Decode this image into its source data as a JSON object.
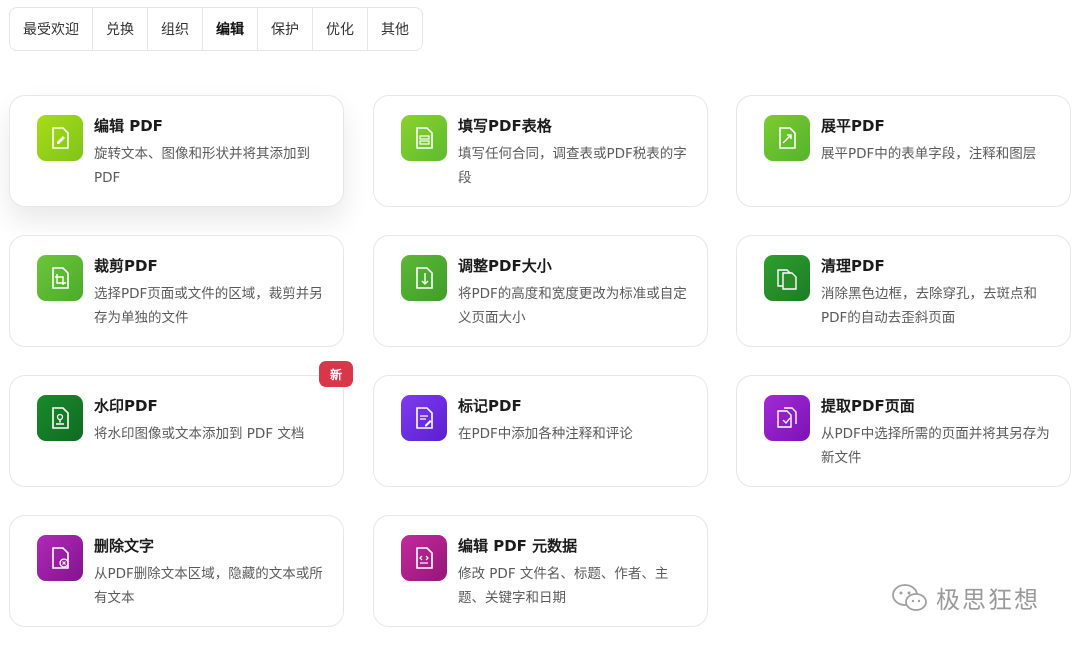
{
  "tabs": [
    "最受欢迎",
    "兑换",
    "组织",
    "编辑",
    "保护",
    "优化",
    "其他"
  ],
  "active_tab": "编辑",
  "cards": [
    {
      "title": "编辑 PDF",
      "desc": "旋转文本、图像和形状并将其添加到 PDF",
      "icon": "edit-pdf-icon",
      "color1": "#a8dc18",
      "color2": "#7fc41a"
    },
    {
      "title": "填写PDF表格",
      "desc": "填写任何合同，调查表或PDF税表的字段",
      "icon": "fill-form-icon",
      "color1": "#8bd22e",
      "color2": "#5dbb2e"
    },
    {
      "title": "展平PDF",
      "desc": "展平PDF中的表单字段，注释和图层",
      "icon": "flatten-pdf-icon",
      "color1": "#7acc32",
      "color2": "#55b32b"
    },
    {
      "title": "裁剪PDF",
      "desc": "选择PDF页面或文件的区域，裁剪并另存为单独的文件",
      "icon": "crop-pdf-icon",
      "color1": "#6ec43a",
      "color2": "#4aac2c"
    },
    {
      "title": "调整PDF大小",
      "desc": "将PDF的高度和宽度更改为标准或自定义页面大小",
      "icon": "resize-pdf-icon",
      "color1": "#5cb835",
      "color2": "#3f9e2a"
    },
    {
      "title": "清理PDF",
      "desc": "消除黑色边框，去除穿孔，去斑点和PDF的自动去歪斜页面",
      "icon": "clean-pdf-icon",
      "color1": "#2f9e2e",
      "color2": "#1b7d25"
    },
    {
      "title": "水印PDF",
      "desc": "将水印图像或文本添加到 PDF 文档",
      "icon": "watermark-pdf-icon",
      "color1": "#1a8a2c",
      "color2": "#0f6b21",
      "badge": "新"
    },
    {
      "title": "标记PDF",
      "desc": "在PDF中添加各种注释和评论",
      "icon": "markup-pdf-icon",
      "color1": "#7d3cf0",
      "color2": "#5a1fd0"
    },
    {
      "title": "提取PDF页面",
      "desc": "从PDF中选择所需的页面并将其另存为新文件",
      "icon": "extract-pages-icon",
      "color1": "#a22ad6",
      "color2": "#7c12b5"
    },
    {
      "title": "删除文字",
      "desc": "从PDF删除文本区域，隐藏的文本或所有文本",
      "icon": "delete-text-icon",
      "color1": "#b02ab8",
      "color2": "#82138f"
    },
    {
      "title": "编辑 PDF 元数据",
      "desc": "修改 PDF 文件名、标题、作者、主题、关键字和日期",
      "icon": "edit-metadata-icon",
      "color1": "#c42a9c",
      "color2": "#941678"
    }
  ],
  "watermark_text": "极思狂想"
}
